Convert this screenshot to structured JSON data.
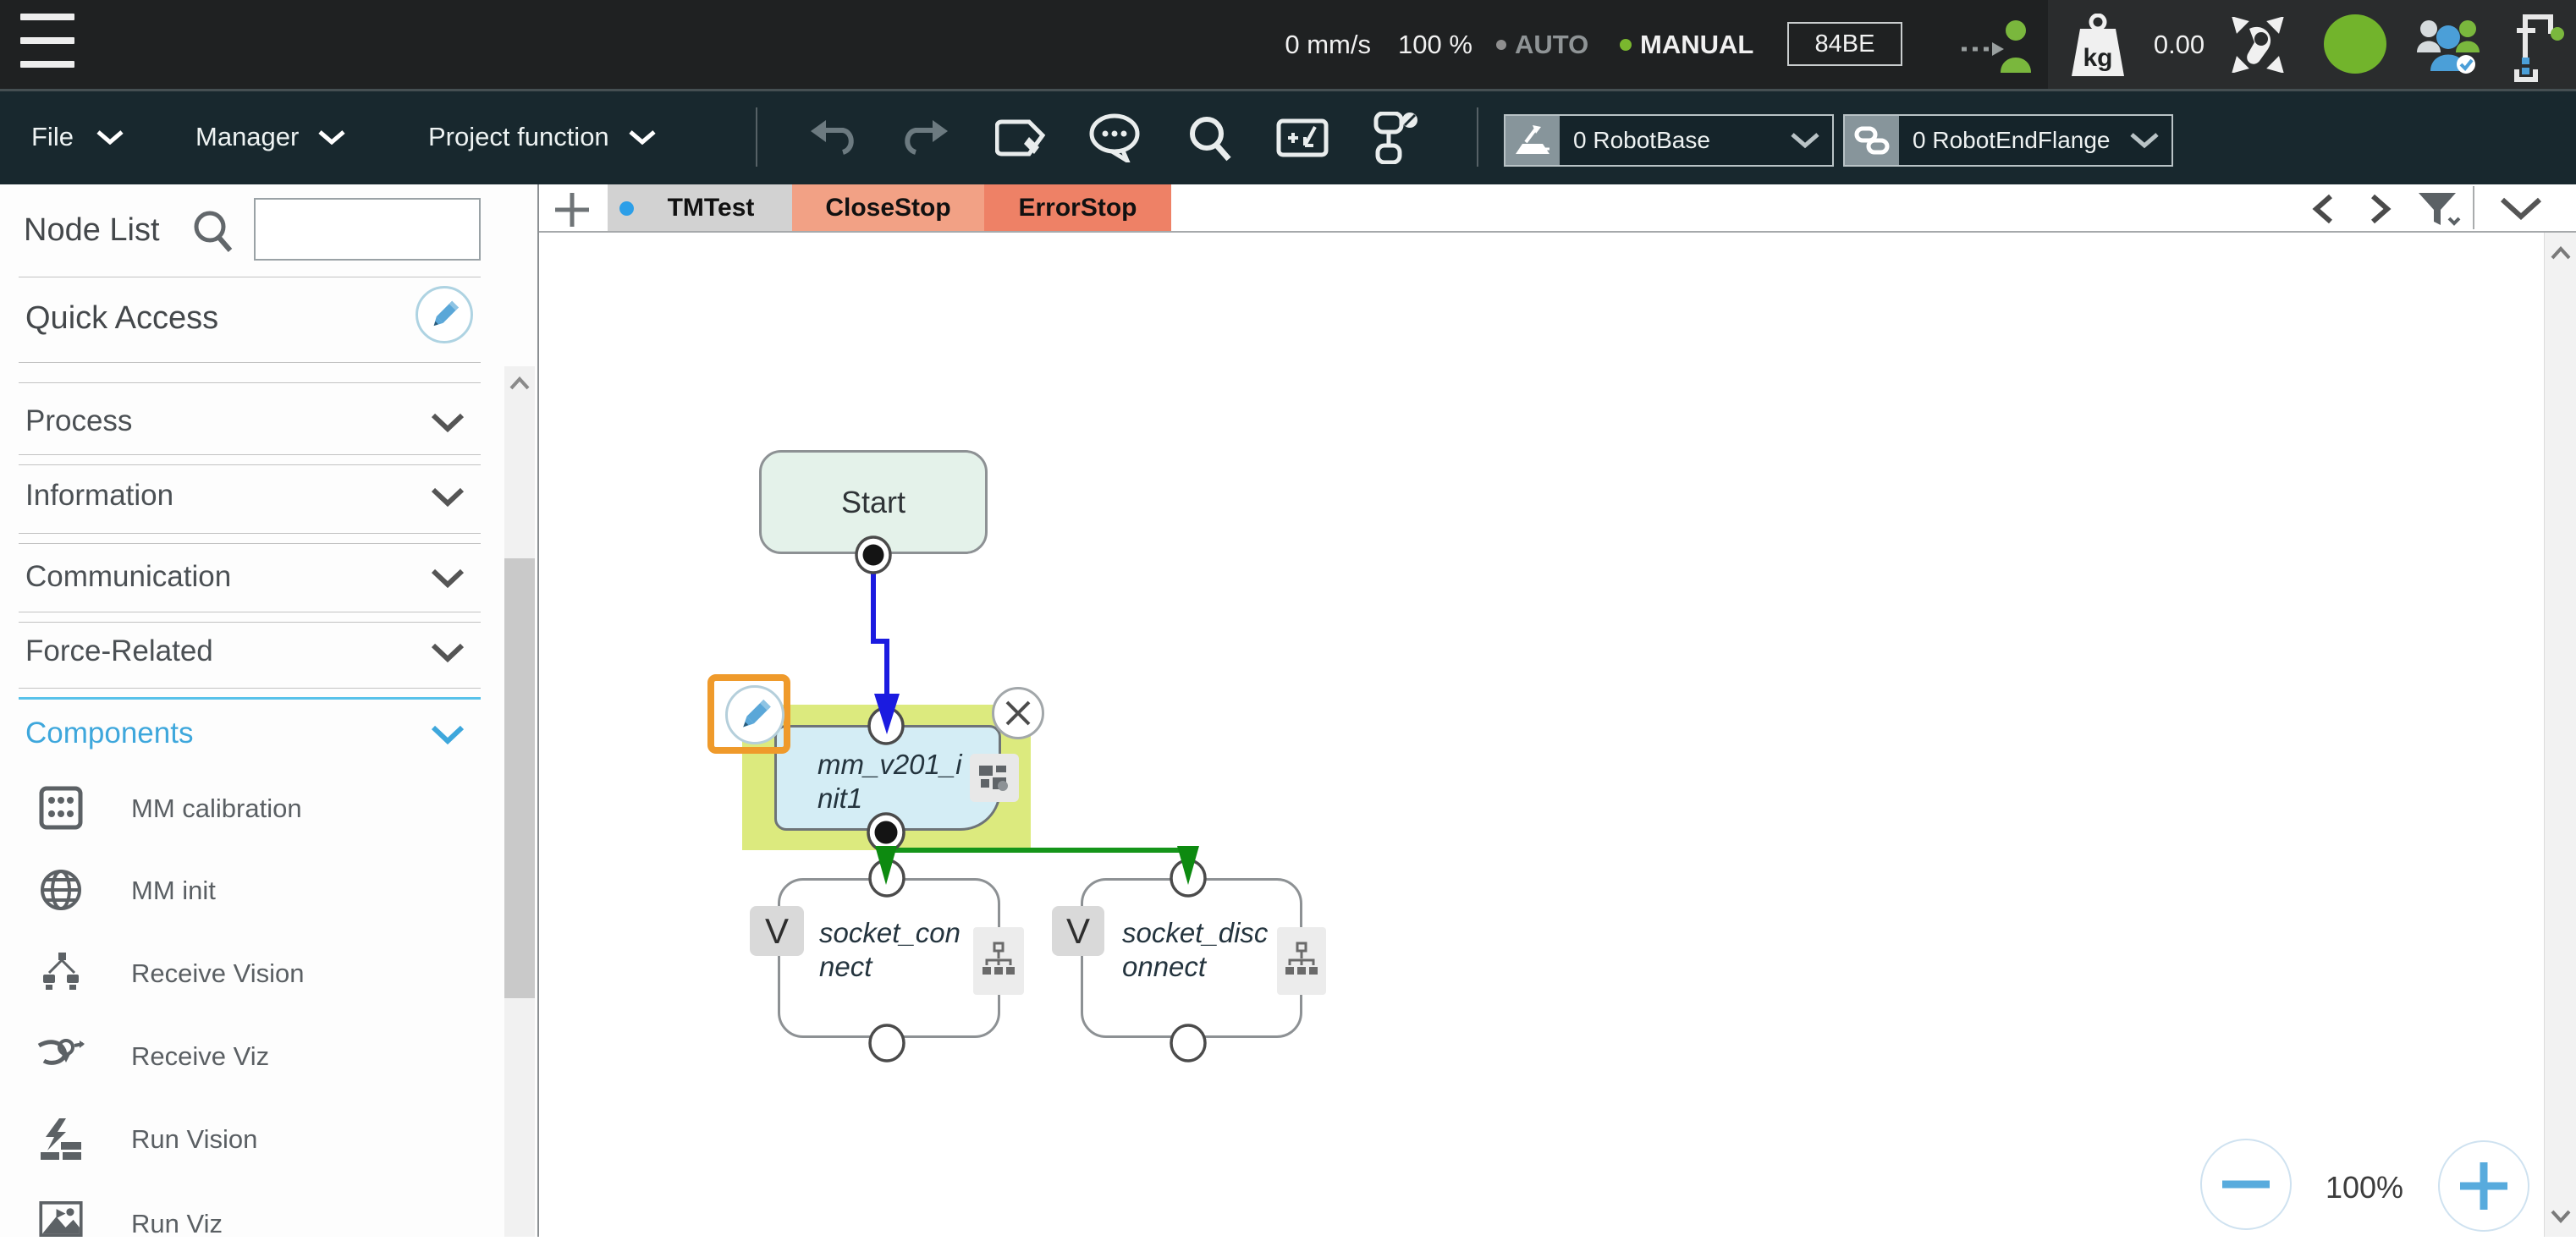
{
  "topbar": {
    "speed": "0 mm/s",
    "speed_percent": "100 %",
    "mode_auto": "AUTO",
    "mode_manual": "MANUAL",
    "robot_id": "84BE",
    "payload_value": "0.00",
    "payload_unit": "kg"
  },
  "menubar": {
    "file": "File",
    "manager": "Manager",
    "project_function": "Project function",
    "robot_base": "0 RobotBase",
    "robot_end_flange": "0 RobotEndFlange"
  },
  "sidebar": {
    "title": "Node List",
    "search_value": "",
    "quick_access": "Quick Access",
    "sections": [
      {
        "label": "Process"
      },
      {
        "label": "Information"
      },
      {
        "label": "Communication"
      },
      {
        "label": "Force-Related"
      },
      {
        "label": "Components"
      }
    ],
    "components_items": [
      {
        "icon": "calibration-board-icon",
        "label": "MM calibration"
      },
      {
        "icon": "globe-icon",
        "label": "MM init"
      },
      {
        "icon": "receive-vision-icon",
        "label": "Receive Vision"
      },
      {
        "icon": "receive-viz-icon",
        "label": "Receive Viz"
      },
      {
        "icon": "run-vision-icon",
        "label": "Run Vision"
      },
      {
        "icon": "run-viz-icon",
        "label": "Run Viz"
      }
    ]
  },
  "tabs": {
    "items": [
      {
        "label": "TMTest",
        "active": true
      },
      {
        "label": "CloseStop"
      },
      {
        "label": "ErrorStop"
      }
    ]
  },
  "flow": {
    "start_label": "Start",
    "selected_node": {
      "label": "mm_v201_init1"
    },
    "child_nodes": [
      {
        "badge": "V",
        "label": "socket_connect"
      },
      {
        "badge": "V",
        "label": "socket_disconnect"
      }
    ]
  },
  "zoom_control": {
    "level": "100%"
  },
  "colors": {
    "accent_blue": "#3ea7dc",
    "selection_highlight": "#dcea7e",
    "selection_outline": "#ef9a2b",
    "connector_blue": "#1b1be0",
    "connector_green": "#15951a",
    "status_green": "#76b82a",
    "tab_active": "#d2d2d2",
    "tab_closestop": "#f2a185",
    "tab_errorstop": "#ee8166",
    "node_fill_start": "#e4f2ea",
    "node_fill_selected": "#d4edf5"
  }
}
